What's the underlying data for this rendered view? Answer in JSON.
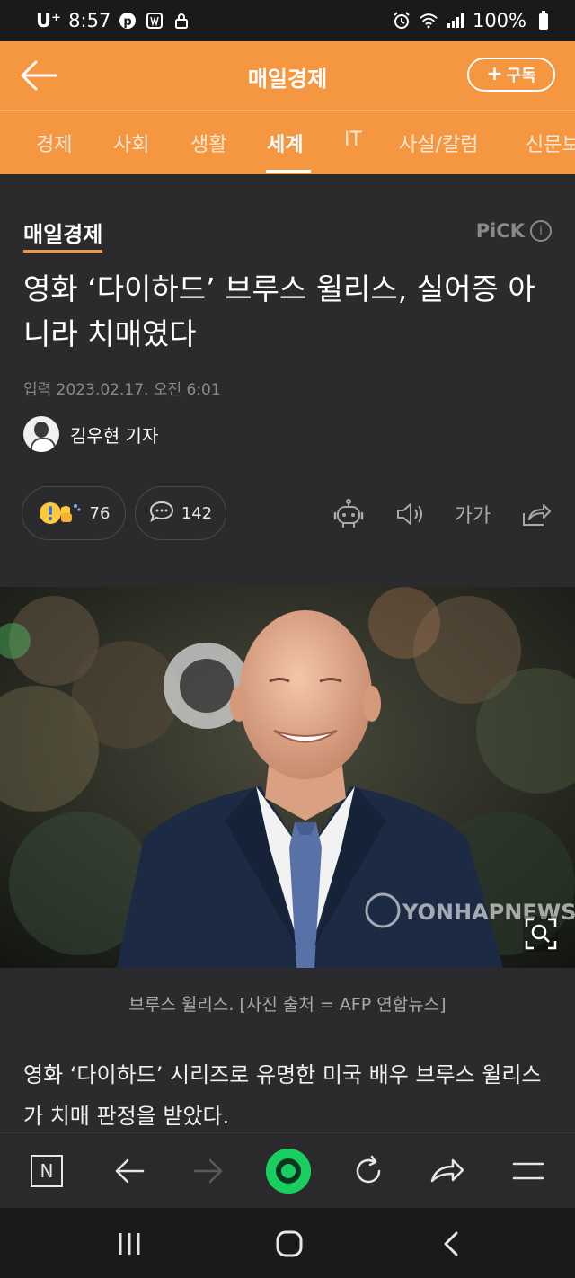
{
  "status_bar": {
    "carrier": "U⁺",
    "time": "8:57",
    "battery": "100%"
  },
  "header": {
    "title": "매일경제",
    "subscribe_label": "구독"
  },
  "tabs": [
    {
      "label": "경제"
    },
    {
      "label": "사회"
    },
    {
      "label": "생활"
    },
    {
      "label": "세계"
    },
    {
      "label": "IT"
    },
    {
      "label": "사설/칼럼"
    },
    {
      "label": "신문보"
    }
  ],
  "article": {
    "press_name": "매일경제",
    "pick_label": "PiCK",
    "headline": "영화 ‘다이하드’ 브루스 윌리스, 실어증 아니라 치매였다",
    "date": "입력 2023.02.17. 오전 6:01",
    "reporter": "김우현 기자",
    "reaction_count": "76",
    "comment_count": "142",
    "font_size_label": "가가",
    "photo_watermark": "YONHAP NEWS",
    "caption": "브루스 윌리스. [사진 출처 = AFP 연합뉴스]",
    "body": "영화 ‘다이하드’ 시리즈로 유명한 미국 배우 브루스 윌리스가 치매 판정을 받았다."
  },
  "browser_bar": {
    "home_icon_text": "N"
  },
  "colors": {
    "brand_orange": "#f59640",
    "background": "#2b2b2d",
    "naver_green": "#19ce60"
  }
}
